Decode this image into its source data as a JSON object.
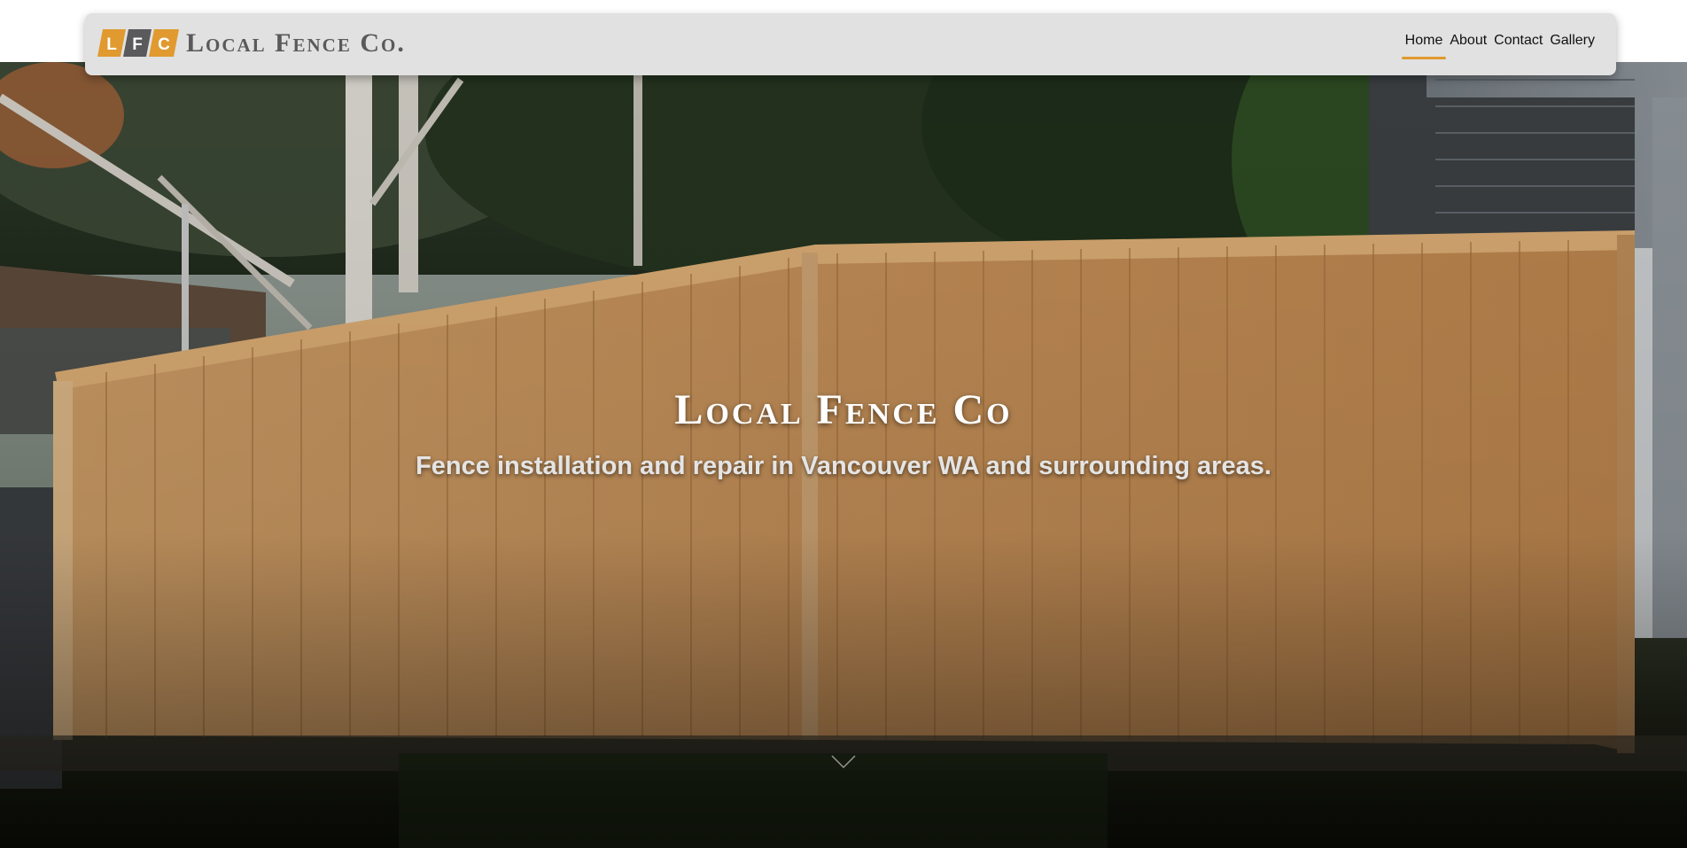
{
  "brand": {
    "logo_letters": [
      "L",
      "F",
      "C"
    ],
    "logo_text": "Local Fence Co.",
    "accent_color": "#e09a2f",
    "logo_dark_color": "#5a5a5c"
  },
  "nav": {
    "items": [
      {
        "label": "Home",
        "active": true
      },
      {
        "label": "About",
        "active": false
      },
      {
        "label": "Contact",
        "active": false
      },
      {
        "label": "Gallery",
        "active": false
      }
    ]
  },
  "hero": {
    "title": "Local Fence Co",
    "subtitle": "Fence installation and repair in Vancouver WA and surrounding areas.",
    "background_image": "wooden privacy fence photo",
    "scroll_icon": "chevron-down-icon"
  }
}
